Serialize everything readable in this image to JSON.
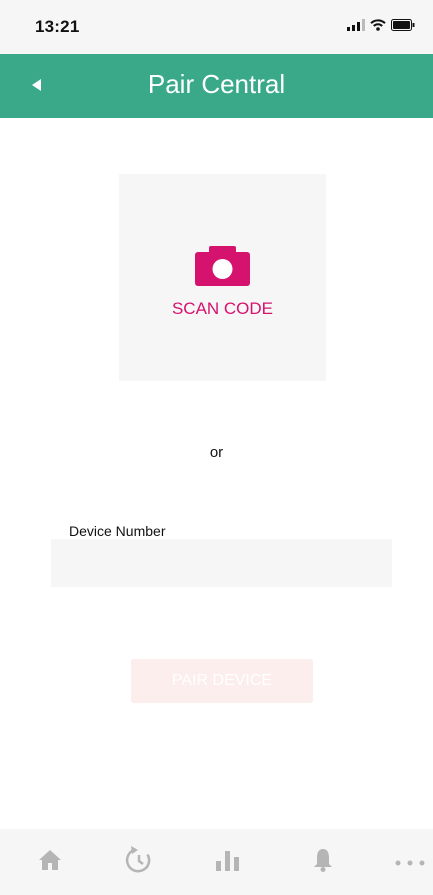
{
  "status_bar": {
    "time": "13:21",
    "icons": [
      "signal-icon",
      "wifi-icon",
      "battery-icon"
    ]
  },
  "header": {
    "title": "Pair Central",
    "back_icon": "back-arrow-icon",
    "color": "#3aa98a"
  },
  "scan": {
    "label": "SCAN CODE",
    "icon": "camera-icon",
    "color": "#d5126e"
  },
  "separator": "or",
  "device_field": {
    "label": "Device Number",
    "value": "",
    "placeholder": ""
  },
  "pair_button": {
    "label": "PAIR DEVICE",
    "state": "disabled"
  },
  "tab_bar": {
    "items": [
      {
        "icon": "home-icon"
      },
      {
        "icon": "history-icon"
      },
      {
        "icon": "chart-icon"
      },
      {
        "icon": "bell-icon"
      },
      {
        "icon": "more-icon"
      }
    ]
  }
}
